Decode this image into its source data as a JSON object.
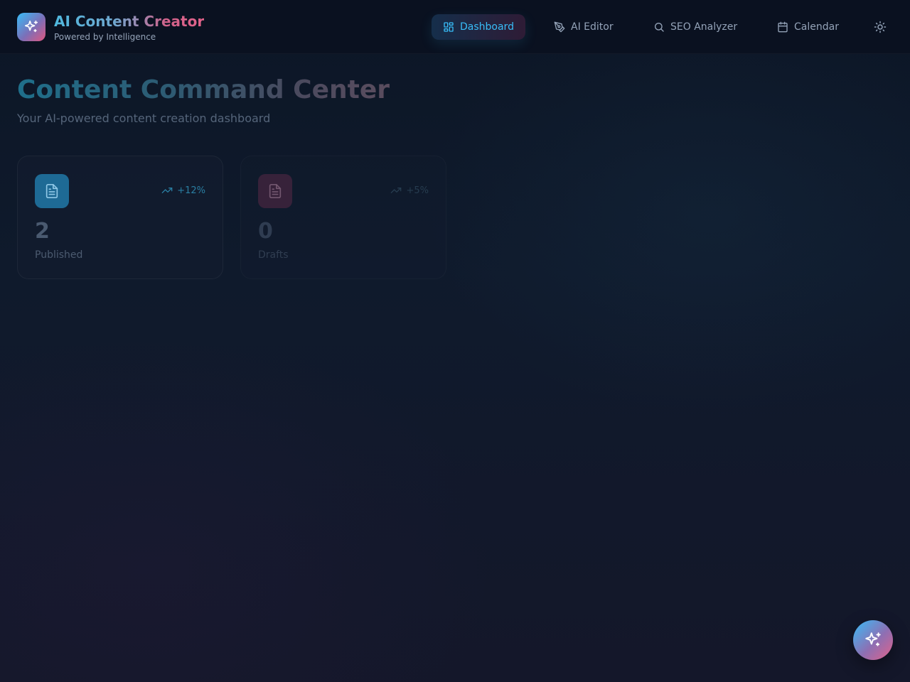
{
  "header": {
    "brand_title": "AI Content Creator",
    "brand_subtitle": "Powered by Intelligence",
    "nav": [
      {
        "label": "Dashboard",
        "icon": "grid-icon",
        "active": true
      },
      {
        "label": "AI Editor",
        "icon": "pen-icon",
        "active": false
      },
      {
        "label": "SEO Analyzer",
        "icon": "search-icon",
        "active": false
      },
      {
        "label": "Calendar",
        "icon": "calendar-icon",
        "active": false
      }
    ],
    "theme_toggle_icon": "sun-icon"
  },
  "main": {
    "title": "Content Command Center",
    "subtitle": "Your AI-powered content creation dashboard",
    "stats": [
      {
        "value": "2",
        "label": "Published",
        "trend": "+12%",
        "icon": "document-icon",
        "color": "#1e6a95"
      },
      {
        "value": "0",
        "label": "Drafts",
        "trend": "+5%",
        "icon": "document-icon",
        "color": "#5a2a48"
      }
    ]
  },
  "fab": {
    "icon": "sparkles-icon"
  },
  "colors": {
    "accent": "#38bdf8",
    "accent_pink": "#e2628a",
    "background": "#0f1a2c"
  }
}
